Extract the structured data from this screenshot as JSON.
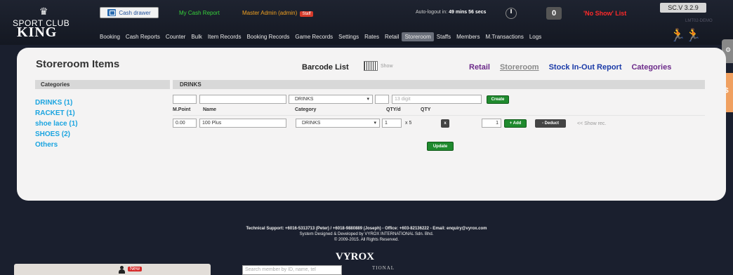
{
  "header": {
    "logo_line1": "SPORT CLUB",
    "logo_line2": "KING",
    "cash_drawer": "Cash drawer",
    "my_cash_report": "My Cash Report",
    "master_admin": "Master Admin (admin)",
    "staff_badge": "Staff",
    "autologout_label": "Auto-logout in:",
    "autologout_time": "49 mins 56 secs",
    "counter_value": "0",
    "no_show": "'No Show' List",
    "version": "SC.V 3.2.9",
    "lmt": "LMT02-DEMO"
  },
  "nav": {
    "items": [
      "Booking",
      "Cash Reports",
      "Counter",
      "Bulk",
      "Item Records",
      "Booking Records",
      "Game Records",
      "Settings",
      "Rates",
      "Retail",
      "Storeroom",
      "Staffs",
      "Members",
      "M.Transactions",
      "Logs"
    ],
    "active": "Storeroom"
  },
  "page": {
    "title": "Storeroom Items",
    "barcode_list": "Barcode List",
    "barcode_show": "Show",
    "links": {
      "retail": "Retail",
      "storeroom": "Storeroom",
      "stock": "Stock In-Out Report",
      "categories": "Categories"
    }
  },
  "sidebar": {
    "header": "Categories",
    "items": [
      "DRINKS (1)",
      "RACKET (1)",
      "shoe lace (1)",
      "SHOES (2)",
      "Others"
    ]
  },
  "table": {
    "header": "DRINKS",
    "new_row": {
      "category": "DRINKS",
      "barcode_placeholder": "13 digit",
      "create": "Create"
    },
    "columns": [
      "M.Point",
      "Name",
      "Category",
      "QTY/d",
      "QTY"
    ],
    "rows": [
      {
        "m_point": "0.00",
        "name": "100 Plus",
        "category": "DRINKS",
        "qty_d": "1",
        "multiplier": "x 5",
        "remove": "x",
        "qty": "1",
        "add": "+ Add",
        "deduct": "- Deduct",
        "show_rec": "<< Show rec."
      }
    ],
    "update": "Update"
  },
  "footer": {
    "line1": "Technical Support: +6016-5313713 (Peter) / +6018-9880889 (Joseph) - Office: +603-82136222 - Email: enquiry@vyrox.com",
    "line2": "System Designed & Developed by VYROX INTERNATIONAL Sdn. Bhd.",
    "line3": "© 2009-2015. All Rights Reserved.",
    "brand": "VYROX",
    "brand_sub": "TIONAL"
  },
  "bottom": {
    "new_badge": "New",
    "search_placeholder": "Search member by ID, name, tel"
  },
  "colors": {
    "background": "#1a1f2e",
    "panel": "#f4f3f3",
    "category_link": "#1aa4e0",
    "green_button": "#1f8a2e",
    "no_show": "#ff2a2a"
  }
}
